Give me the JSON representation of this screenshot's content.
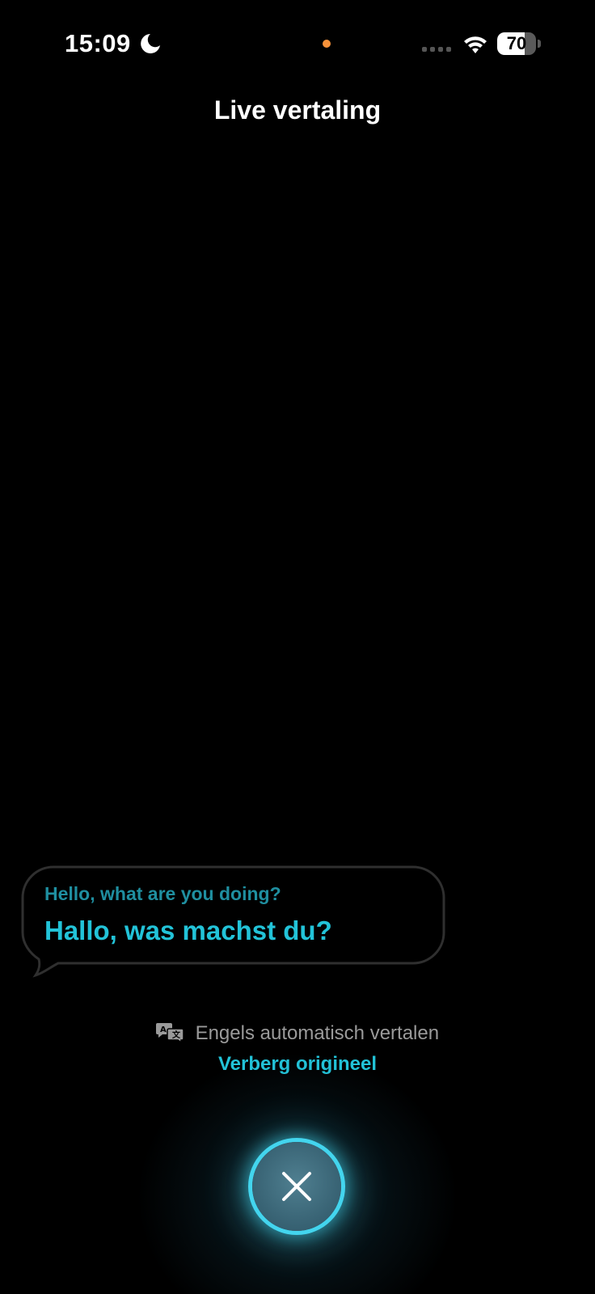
{
  "status_bar": {
    "time": "15:09",
    "battery_percent": "70",
    "battery_level": 0.7,
    "icons": [
      "moon-icon",
      "microphone-indicator",
      "signal-icon",
      "wifi-icon",
      "battery-icon"
    ],
    "mic_indicator_color": "#f7923a"
  },
  "header": {
    "title": "Live vertaling"
  },
  "bubble": {
    "original": "Hello, what are you doing?",
    "translated": "Hallo, was machst du?",
    "original_color": "#1f8fa0",
    "translated_color": "#22c3d8"
  },
  "controls": {
    "auto_translate_label": "Engels automatisch vertalen",
    "auto_translate_icon": "translate-icon",
    "hide_original_label": "Verberg origineel",
    "close_icon": "close-icon",
    "accent_color": "#22c3d8"
  }
}
